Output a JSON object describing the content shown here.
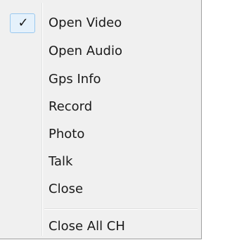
{
  "menu": {
    "items": [
      {
        "label": "Open Video",
        "checked": true,
        "check_glyph": "✓"
      },
      {
        "label": "Open Audio",
        "checked": false
      },
      {
        "label": "Gps Info",
        "checked": false
      },
      {
        "label": "Record",
        "checked": false
      },
      {
        "label": "Photo",
        "checked": false
      },
      {
        "label": "Talk",
        "checked": false
      },
      {
        "label": "Close",
        "checked": false
      }
    ],
    "after_separator": [
      {
        "label": "Close All CH",
        "checked": false
      }
    ]
  }
}
